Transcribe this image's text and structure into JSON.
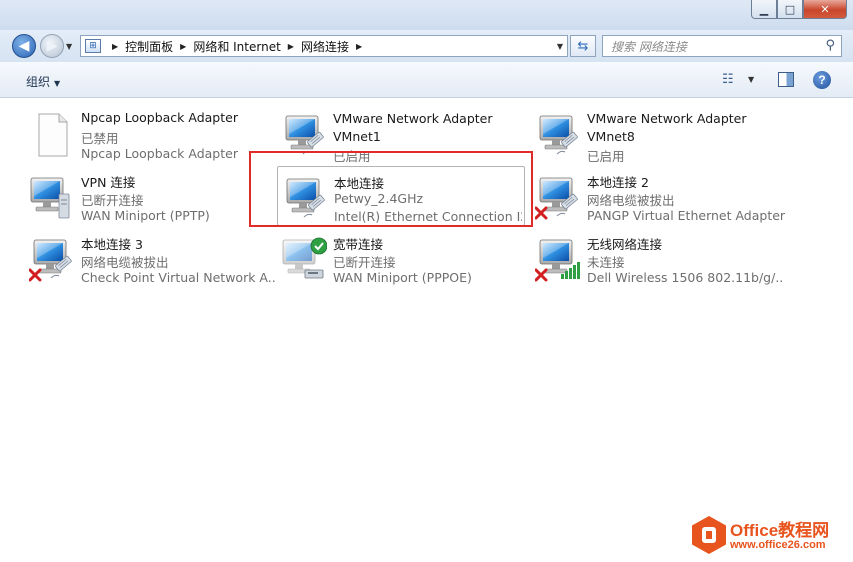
{
  "window": {
    "caption": {
      "minimize": "▁",
      "maximize": "□",
      "close": "✕"
    }
  },
  "address": {
    "crumbs": [
      "控制面板",
      "网络和 Internet",
      "网络连接"
    ],
    "search_placeholder": "搜索 网络连接"
  },
  "toolbar": {
    "organize_label": "组织",
    "help_label": "?"
  },
  "adapters": [
    {
      "name": "Npcap Loopback Adapter",
      "status": "已禁用",
      "device": "Npcap Loopback Adapter",
      "icon": "blank-document-icon"
    },
    {
      "name": "VMware Network Adapter VMnet1",
      "status": "已启用",
      "device": "",
      "icon": "network-adapter-icon"
    },
    {
      "name": "VMware Network Adapter VMnet8",
      "status": "已启用",
      "device": "",
      "icon": "network-adapter-icon"
    },
    {
      "name": "VPN 连接",
      "status": "已断开连接",
      "device": "WAN Miniport (PPTP)",
      "icon": "vpn-adapter-icon"
    },
    {
      "name": "本地连接",
      "status": "Petwy_2.4GHz",
      "device": "Intel(R) Ethernet Connection I2...",
      "icon": "network-adapter-icon",
      "selected": true
    },
    {
      "name": "本地连接 2",
      "status": "网络电缆被拔出",
      "device": "PANGP Virtual Ethernet Adapter",
      "icon": "network-adapter-disconnected-icon"
    },
    {
      "name": "本地连接 3",
      "status": "网络电缆被拔出",
      "device": "Check Point Virtual Network A...",
      "icon": "network-adapter-disconnected-icon"
    },
    {
      "name": "宽带连接",
      "status": "已断开连接",
      "device": "WAN Miniport (PPPOE)",
      "icon": "broadband-adapter-icon"
    },
    {
      "name": "无线网络连接",
      "status": "未连接",
      "device": "Dell Wireless 1506 802.11b/g/...",
      "icon": "wireless-adapter-disconnected-icon"
    }
  ],
  "watermark": {
    "brand": "Office教程网",
    "url": "www.office26.com"
  },
  "colors": {
    "highlight_border": "#e02b2b",
    "watermark": "#e8541e"
  }
}
